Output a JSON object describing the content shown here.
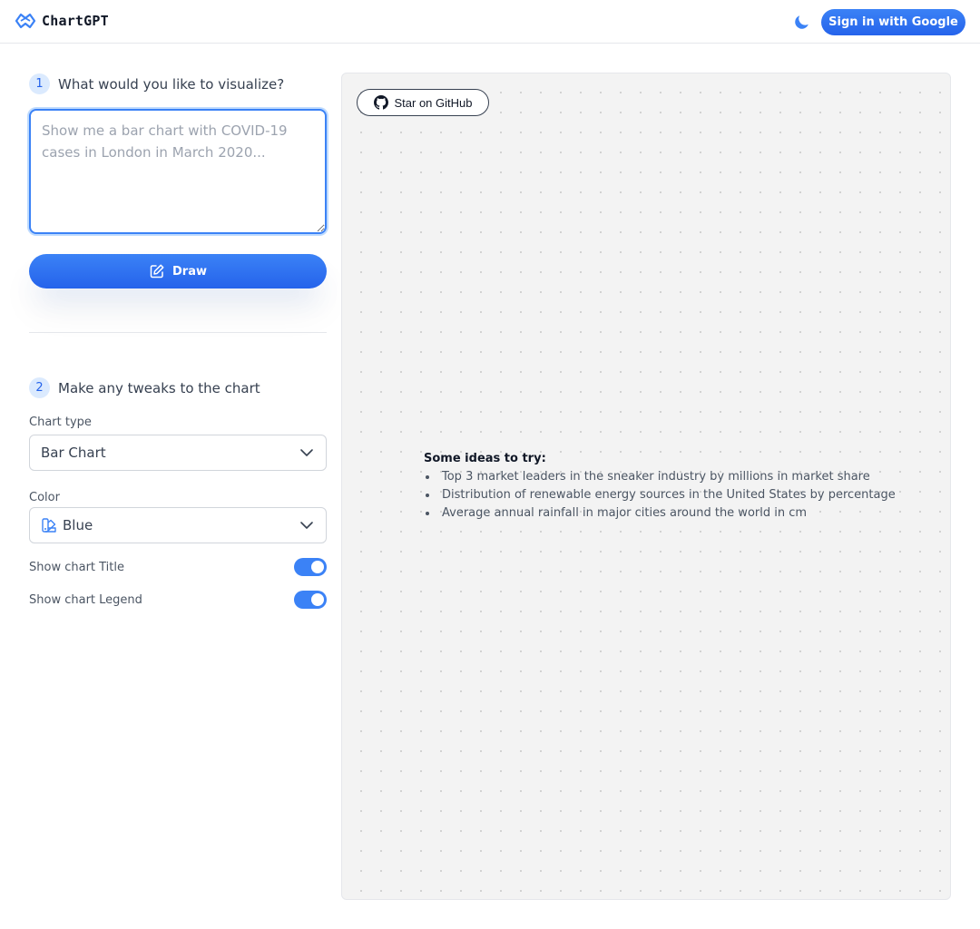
{
  "header": {
    "app_name": "ChartGPT",
    "logo_icon": "chartgpt-logo-icon",
    "theme_icon": "moon-icon",
    "signin_label": "Sign in with Google"
  },
  "step1": {
    "number": "1",
    "label": "What would you like to visualize?",
    "prompt_value": "",
    "prompt_placeholder": "Show me a bar chart with COVID-19 cases in London in March 2020...",
    "draw_label": "Draw",
    "draw_icon": "pencil-square-icon"
  },
  "step2": {
    "number": "2",
    "label": "Make any tweaks to the chart",
    "chart_type_label": "Chart type",
    "chart_type_value": "Bar Chart",
    "color_label": "Color",
    "color_value": "Blue",
    "color_icon": "swatch-icon",
    "show_title_label": "Show chart Title",
    "show_title_on": true,
    "show_legend_label": "Show chart Legend",
    "show_legend_on": true
  },
  "canvas": {
    "github_label": "Star on GitHub",
    "github_icon": "github-icon",
    "ideas_title": "Some ideas to try:",
    "ideas": [
      "Top 3 market leaders in the sneaker industry by millions in market share",
      "Distribution of renewable energy sources in the United States by percentage",
      "Average annual rainfall in major cities around the world in cm"
    ]
  },
  "colors": {
    "accent": "#3b82f6",
    "accent_dark": "#2563eb",
    "canvas_bg": "#f3f3f3"
  }
}
